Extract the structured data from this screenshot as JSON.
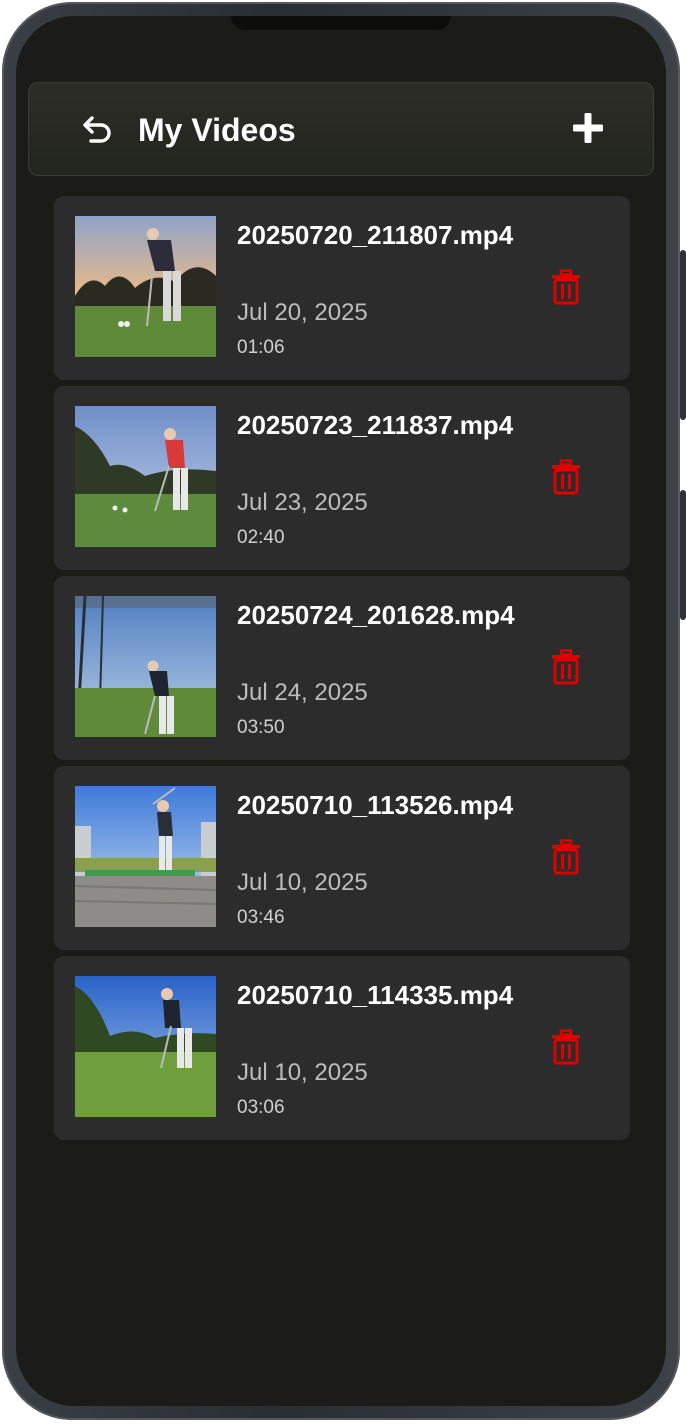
{
  "app": {
    "title": "My Videos",
    "back_icon": "undo-arrow-icon",
    "add_icon": "plus-icon",
    "delete_icon": "trash-icon",
    "accent_delete": "#e00000"
  },
  "videos": [
    {
      "filename": "20250720_211807.mp4",
      "date": "Jul 20, 2025",
      "duration": "01:06"
    },
    {
      "filename": "20250723_211837.mp4",
      "date": "Jul 23, 2025",
      "duration": "02:40"
    },
    {
      "filename": "20250724_201628.mp4",
      "date": "Jul 24, 2025",
      "duration": "03:50"
    },
    {
      "filename": "20250710_113526.mp4",
      "date": "Jul 10, 2025",
      "duration": "03:46"
    },
    {
      "filename": "20250710_114335.mp4",
      "date": "Jul 10, 2025",
      "duration": "03:06"
    }
  ]
}
